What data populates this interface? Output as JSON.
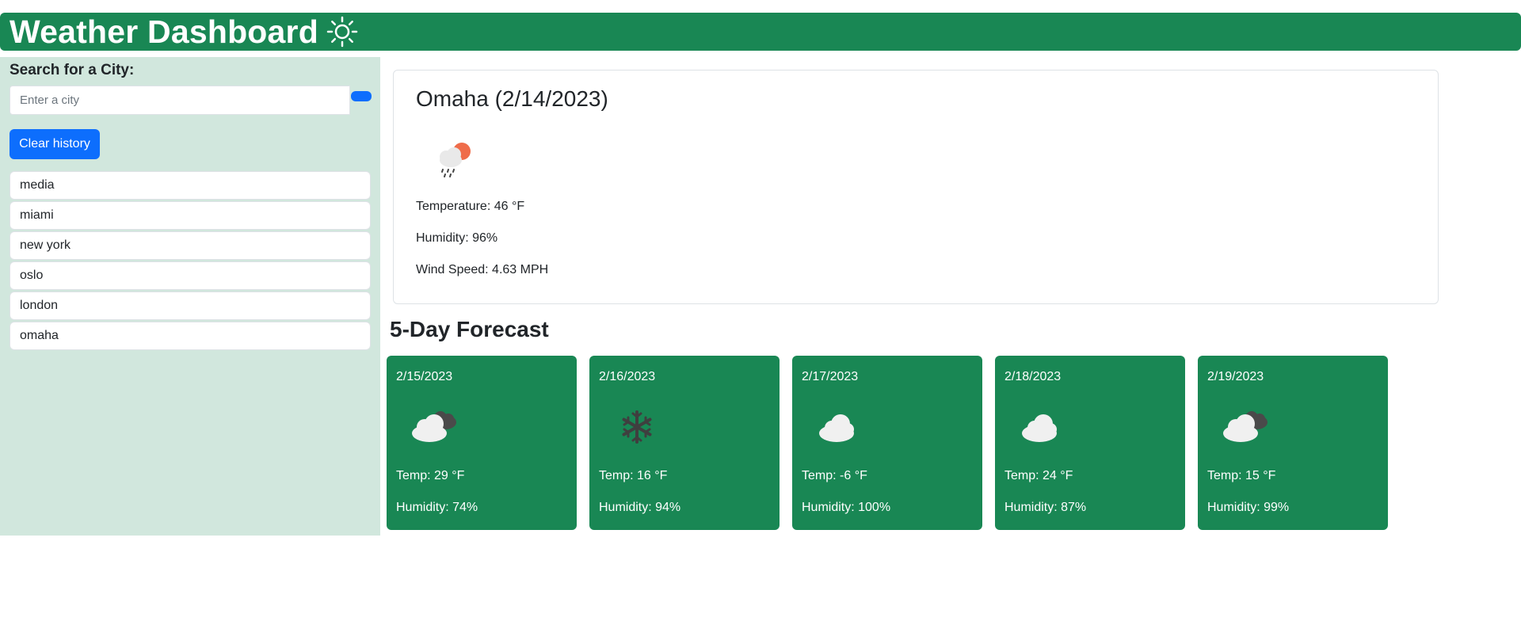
{
  "header": {
    "title": "Weather Dashboard",
    "icon": "sun-icon"
  },
  "sidebar": {
    "search_label": "Search for a City:",
    "search_placeholder": "Enter a city",
    "search_value": "",
    "clear_label": "Clear history",
    "history": [
      "media",
      "miami",
      "new york",
      "oslo",
      "london",
      "omaha"
    ]
  },
  "current": {
    "title": "Omaha (2/14/2023)",
    "icon": "rain-sun-icon",
    "temperature": "Temperature: 46 °F",
    "humidity": "Humidity: 96%",
    "wind": "Wind Speed: 4.63 MPH"
  },
  "forecast": {
    "heading": "5-Day Forecast",
    "days": [
      {
        "date": "2/15/2023",
        "icon": "broken-clouds-icon",
        "temp": "Temp: 29 °F",
        "humidity": "Humidity: 74%"
      },
      {
        "date": "2/16/2023",
        "icon": "snow-icon",
        "temp": "Temp: 16 °F",
        "humidity": "Humidity: 94%"
      },
      {
        "date": "2/17/2023",
        "icon": "cloud-icon",
        "temp": "Temp: -6 °F",
        "humidity": "Humidity: 100%"
      },
      {
        "date": "2/18/2023",
        "icon": "cloud-icon",
        "temp": "Temp: 24 °F",
        "humidity": "Humidity: 87%"
      },
      {
        "date": "2/19/2023",
        "icon": "broken-clouds-icon",
        "temp": "Temp: 15 °F",
        "humidity": "Humidity: 99%"
      }
    ]
  },
  "colors": {
    "header_bg": "#198754",
    "sidebar_bg": "#d1e7dd",
    "primary_button": "#0d6efd",
    "forecast_card_bg": "#198754"
  }
}
